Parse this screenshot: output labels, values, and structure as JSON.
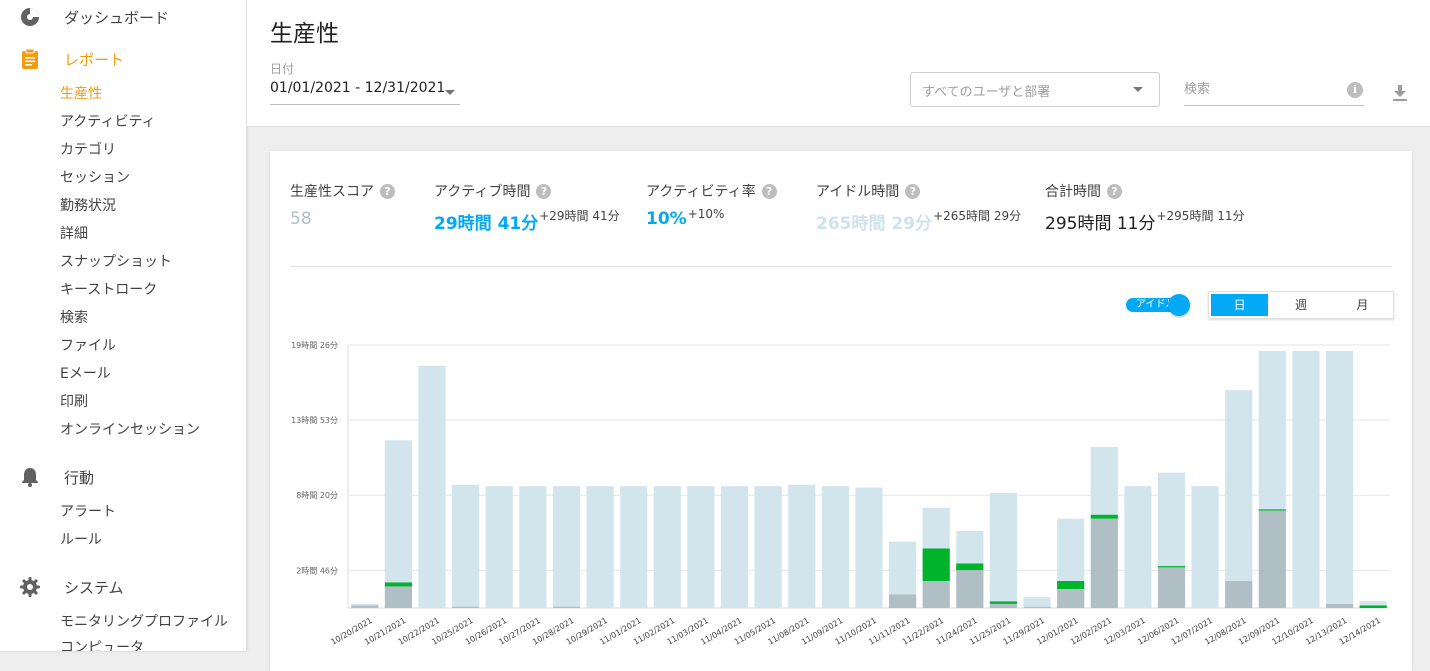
{
  "sidebar": {
    "sections": [
      {
        "label": "ダッシュボード",
        "icon": "dashboard-icon",
        "active": false
      },
      {
        "label": "レポート",
        "icon": "clipboard-icon",
        "active": true
      },
      {
        "label": "行動",
        "icon": "bell-icon",
        "active": false
      },
      {
        "label": "システム",
        "icon": "gear-icon",
        "active": false
      }
    ],
    "report_items": [
      "生産性",
      "アクティビティ",
      "カテゴリ",
      "セッション",
      "勤務状況",
      "詳細",
      "スナップショット",
      "キーストローク",
      "検索",
      "ファイル",
      "Eメール",
      "印刷",
      "オンラインセッション"
    ],
    "behavior_items": [
      "アラート",
      "ルール"
    ],
    "system_items": [
      "モニタリングプロファイル",
      "コンピュータ"
    ]
  },
  "header": {
    "title": "生産性",
    "date_label": "日付",
    "date_value": "01/01/2021 - 12/31/2021",
    "user_placeholder": "すべてのユーザと部署",
    "search_placeholder": "検索"
  },
  "stats": [
    {
      "label": "生産性スコア",
      "value": "58",
      "delta": "",
      "color": "#b0bec5"
    },
    {
      "label": "アクティブ時間",
      "value": "29時間 41分",
      "delta": "+29時間 41分",
      "color": "#03a9f4"
    },
    {
      "label": "アクティビティ率",
      "value": "10%",
      "delta": "+10%",
      "color": "#03a9f4"
    },
    {
      "label": "アイドル時間",
      "value": "265時間 29分",
      "delta": "+265時間 29分",
      "color": "#cfe3ec"
    },
    {
      "label": "合計時間",
      "value": "295時間 11分",
      "delta": "+295時間 11分",
      "color": "#212121"
    }
  ],
  "controls": {
    "idle_toggle_label": "アイドル",
    "period_options": [
      "日",
      "週",
      "月"
    ],
    "period_selected": "日"
  },
  "colors": {
    "accent": "#03a9f4",
    "active_report": "#f39c12",
    "idle": "#d3e5ec",
    "productive": "#00b32c",
    "unproductive": "#b0bec5"
  },
  "chart_data": {
    "type": "bar",
    "stacked": true,
    "y_tick_labels": [
      "2時間 46分",
      "8時間 20分",
      "13時間 53分",
      "19時間 26分"
    ],
    "y_tick_hours": [
      2.7778,
      8.3333,
      13.8889,
      19.4333
    ],
    "ylim": [
      0,
      19.4333
    ],
    "grid": true,
    "categories": [
      "10/20/2021",
      "10/21/2021",
      "10/22/2021",
      "10/25/2021",
      "10/26/2021",
      "10/27/2021",
      "10/28/2021",
      "10/29/2021",
      "11/01/2021",
      "11/02/2021",
      "11/03/2021",
      "11/04/2021",
      "11/05/2021",
      "11/08/2021",
      "11/09/2021",
      "11/10/2021",
      "11/11/2021",
      "11/22/2021",
      "11/24/2021",
      "11/25/2021",
      "11/29/2021",
      "12/01/2021",
      "12/02/2021",
      "12/03/2021",
      "12/06/2021",
      "12/07/2021",
      "12/08/2021",
      "12/09/2021",
      "12/10/2021",
      "12/13/2021",
      "12/14/2021"
    ],
    "series": [
      {
        "key": "unproductive",
        "values": [
          0.2,
          1.6,
          0,
          0.1,
          0,
          0,
          0.1,
          0,
          0,
          0,
          0,
          0,
          0,
          0,
          0,
          0,
          1.0,
          2.0,
          2.8,
          0.3,
          0.1,
          1.4,
          6.6,
          0,
          3.0,
          0,
          2.0,
          7.2,
          0,
          0.3,
          0
        ]
      },
      {
        "key": "productive",
        "values": [
          0,
          0.3,
          0,
          0,
          0,
          0,
          0,
          0,
          0,
          0,
          0,
          0,
          0,
          0,
          0,
          0,
          0,
          2.4,
          0.5,
          0.2,
          0,
          0.6,
          0.3,
          0,
          0.1,
          0,
          0,
          0.1,
          0,
          0,
          0.2
        ]
      },
      {
        "key": "idle",
        "values": [
          0.1,
          10.5,
          17.9,
          9.0,
          9.0,
          9.0,
          8.9,
          9.0,
          9.0,
          9.0,
          9.0,
          9.0,
          9.0,
          9.1,
          9.0,
          8.9,
          3.9,
          3.0,
          2.4,
          8.0,
          0.7,
          4.6,
          5.0,
          9.0,
          6.9,
          9.0,
          14.1,
          11.7,
          19.0,
          18.7,
          0.3
        ]
      }
    ]
  }
}
